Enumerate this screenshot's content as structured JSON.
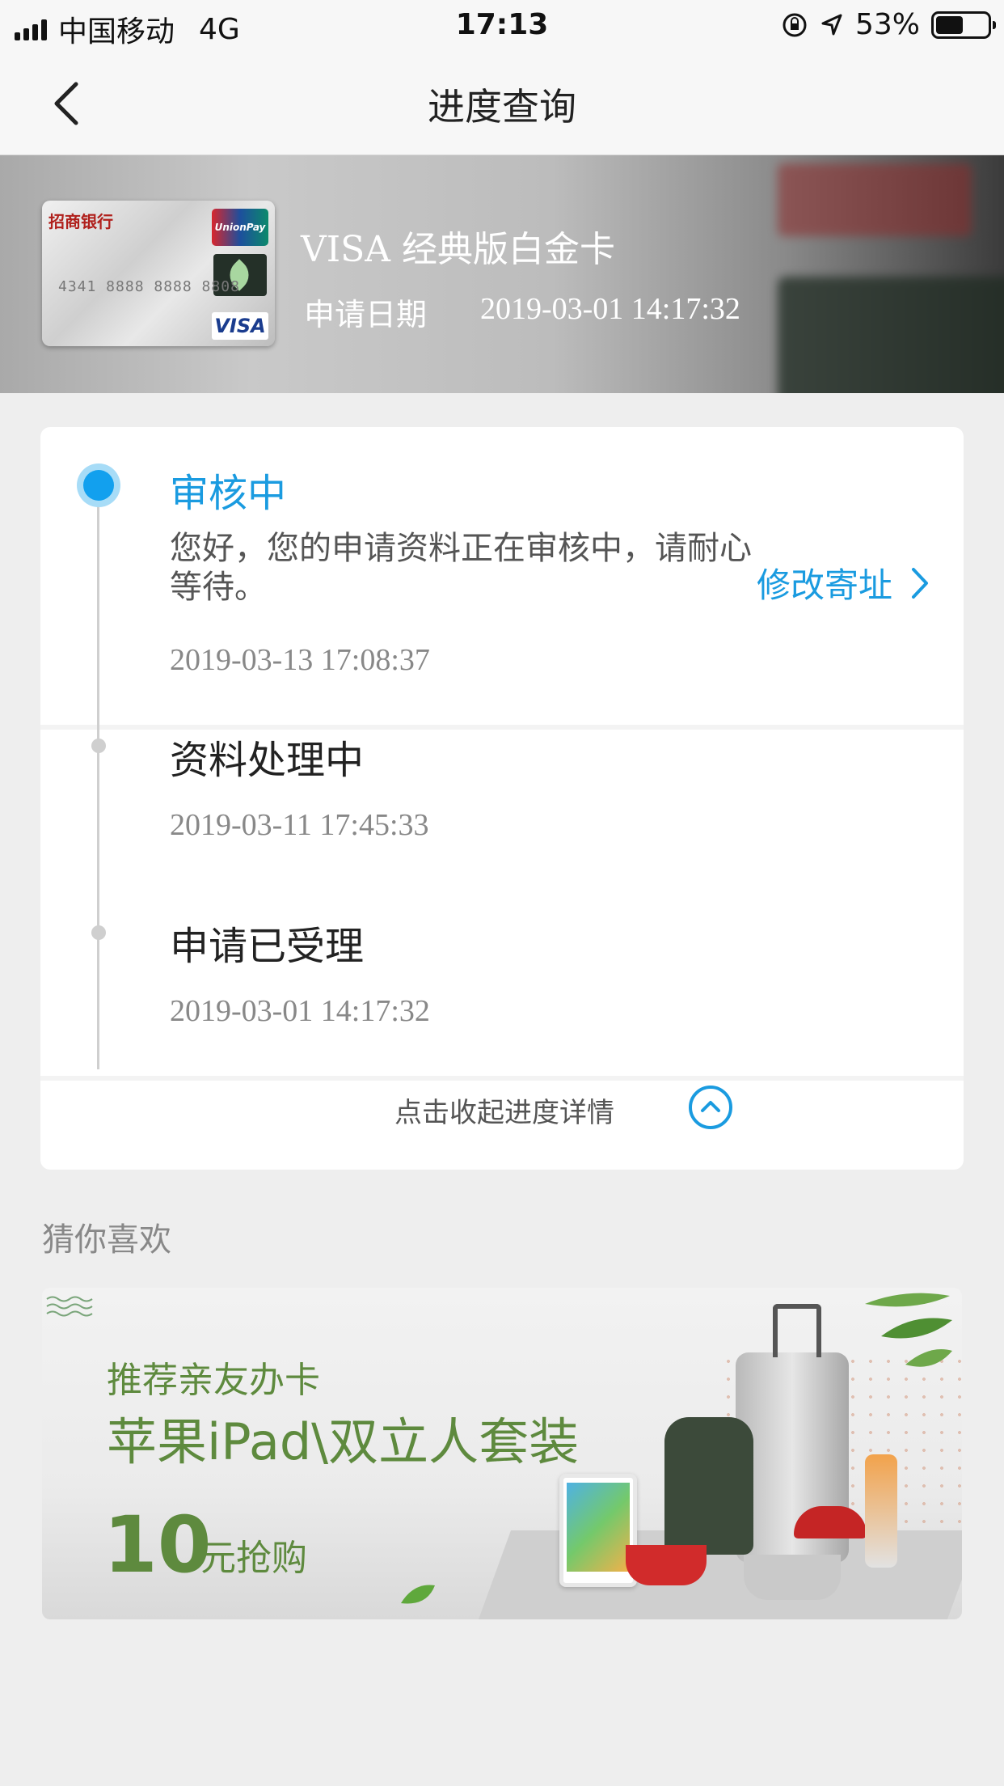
{
  "status_bar": {
    "carrier": "中国移动",
    "network": "4G",
    "time": "17:13",
    "battery": "53%",
    "battery_level": 0.53
  },
  "nav": {
    "title": "进度查询",
    "back_icon": "chevron-left-icon"
  },
  "card": {
    "name": "VISA 经典版白金卡",
    "apply_label": "申请日期",
    "apply_date": "2019-03-01 14:17:32",
    "bank_text": "招商银行",
    "card_number": "4341 8888 8888 8808",
    "unionpay": "UnionPay",
    "network_logo": "VISA"
  },
  "progress": {
    "steps": [
      {
        "title": "审核中",
        "desc": "您好，您的申请资料正在审核中，请耐心等待。",
        "time": "2019-03-13 17:08:37",
        "active": true
      },
      {
        "title": "资料处理中",
        "time": "2019-03-11 17:45:33",
        "active": false
      },
      {
        "title": "申请已受理",
        "time": "2019-03-01 14:17:32",
        "active": false
      }
    ],
    "modify_label": "修改寄址",
    "collapse_label": "点击收起进度详情"
  },
  "recommend": {
    "title": "猜你喜欢",
    "banner": {
      "line1": "推荐亲友办卡",
      "line2": "苹果iPad\\双立人套装",
      "price": "10",
      "unit": "元抢购"
    }
  },
  "colors": {
    "accent": "#1a9be0",
    "banner_green": "#5e8a3e",
    "background": "#eeeeee"
  }
}
